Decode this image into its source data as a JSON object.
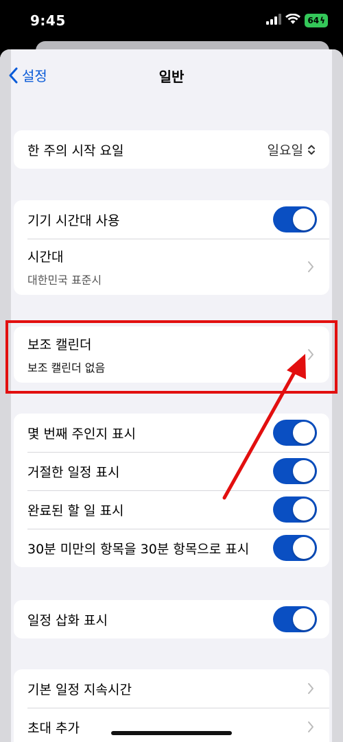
{
  "status": {
    "time": "9:45",
    "battery": "64"
  },
  "nav": {
    "back_label": "설정",
    "title": "일반"
  },
  "week_start": {
    "label": "한 주의 시작 요일",
    "value": "일요일"
  },
  "timezone_group": {
    "device_tz_label": "기기 시간대 사용",
    "device_tz_on": true,
    "timezone_label": "시간대",
    "timezone_value": "대한민국 표준시"
  },
  "alt_calendar": {
    "label": "보조 캘린더",
    "value": "보조 캘린더 없음"
  },
  "display_toggles": [
    {
      "label": "몇 번째 주인지 표시",
      "on": true
    },
    {
      "label": "거절한 일정 표시",
      "on": true
    },
    {
      "label": "완료된 할 일 표시",
      "on": true
    },
    {
      "label": "30분 미만의 항목을 30분 항목으로 표시",
      "on": true
    }
  ],
  "event_illustrations": {
    "label": "일정 삽화 표시",
    "on": true
  },
  "defaults": [
    {
      "label": "기본 일정 지속시간"
    },
    {
      "label": "초대 추가"
    }
  ],
  "colors": {
    "accent": "#0a4fc2",
    "highlight": "#e20f0f"
  }
}
